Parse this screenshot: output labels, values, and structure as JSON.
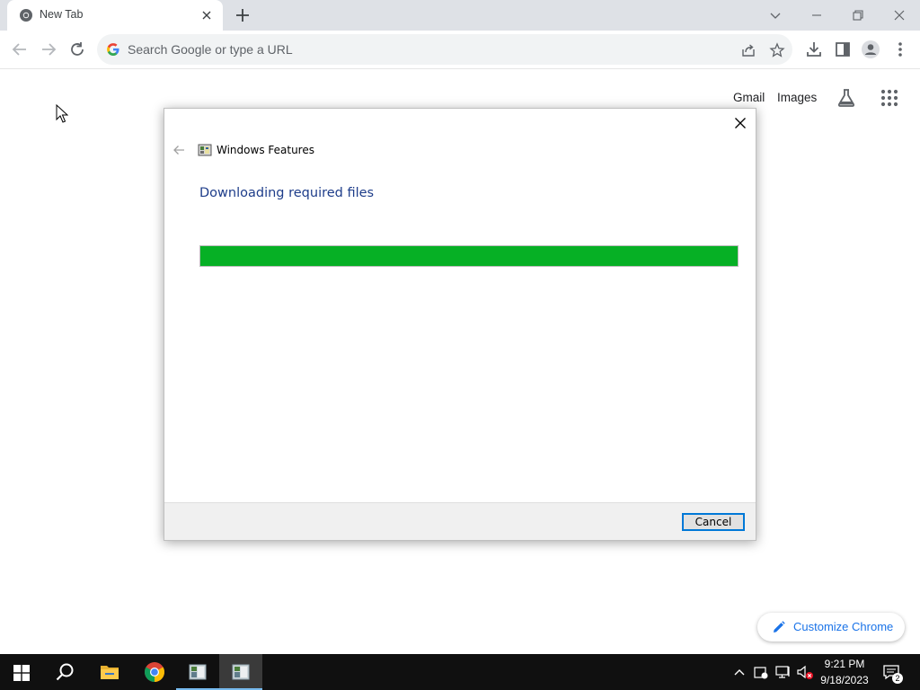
{
  "browser": {
    "tab_title": "New Tab",
    "omnibox_placeholder": "Search Google or type a URL",
    "colors": {
      "tabstrip": "#dee1e6",
      "omnibox": "#f1f3f4"
    }
  },
  "ntp": {
    "links": {
      "gmail": "Gmail",
      "images": "Images"
    },
    "icons": [
      "labs-flask-icon",
      "apps-grid-icon"
    ],
    "customize_label": "Customize Chrome"
  },
  "dialog": {
    "app_title": "Windows Features",
    "heading": "Downloading required files",
    "progress_fraction": 1.0,
    "cancel_label": "Cancel",
    "colors": {
      "heading": "#1e3d8a",
      "progress": "#06b025"
    }
  },
  "taskbar": {
    "apps": [
      "start-icon",
      "search-icon",
      "file-explorer-icon",
      "chrome-icon",
      "windows-features-icon",
      "windows-features-active-icon"
    ],
    "time": "9:21 PM",
    "date": "9/18/2023",
    "notification_count": "2"
  }
}
